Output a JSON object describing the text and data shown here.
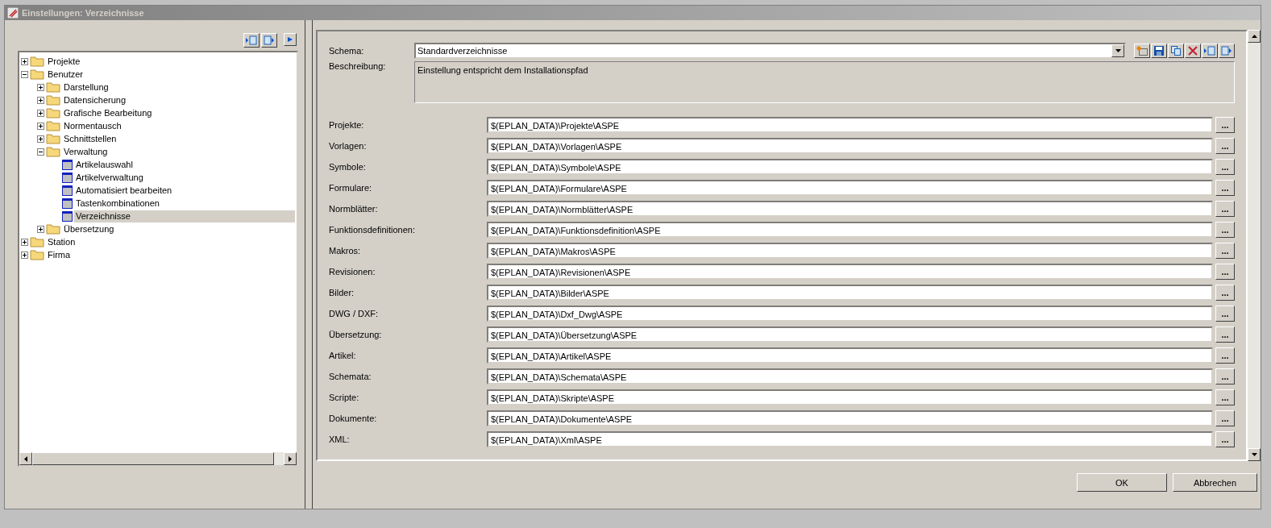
{
  "window": {
    "title": "Einstellungen: Verzeichnisse"
  },
  "tree": {
    "items": [
      {
        "kind": "folder",
        "label": "Projekte",
        "expanded": false,
        "selected": false
      },
      {
        "kind": "folder",
        "label": "Benutzer",
        "expanded": true,
        "selected": false,
        "children": [
          {
            "kind": "folder",
            "label": "Darstellung",
            "expanded": false,
            "selected": false
          },
          {
            "kind": "folder",
            "label": "Datensicherung",
            "expanded": false,
            "selected": false
          },
          {
            "kind": "folder",
            "label": "Grafische Bearbeitung",
            "expanded": false,
            "selected": false
          },
          {
            "kind": "folder",
            "label": "Normentausch",
            "expanded": false,
            "selected": false
          },
          {
            "kind": "folder",
            "label": "Schnittstellen",
            "expanded": false,
            "selected": false
          },
          {
            "kind": "folder",
            "label": "Verwaltung",
            "expanded": true,
            "selected": false,
            "children": [
              {
                "kind": "page",
                "label": "Artikelauswahl",
                "selected": false
              },
              {
                "kind": "page",
                "label": "Artikelverwaltung",
                "selected": false
              },
              {
                "kind": "page",
                "label": "Automatisiert bearbeiten",
                "selected": false
              },
              {
                "kind": "page",
                "label": "Tastenkombinationen",
                "selected": false
              },
              {
                "kind": "page",
                "label": "Verzeichnisse",
                "selected": true
              }
            ]
          },
          {
            "kind": "folder",
            "label": "Übersetzung",
            "expanded": false,
            "selected": false
          }
        ]
      },
      {
        "kind": "folder",
        "label": "Station",
        "expanded": false,
        "selected": false
      },
      {
        "kind": "folder",
        "label": "Firma",
        "expanded": false,
        "selected": false
      }
    ]
  },
  "schema": {
    "label": "Schema:",
    "value": "Standardverzeichnisse"
  },
  "description": {
    "label": "Beschreibung:",
    "value": "Einstellung entspricht dem Installationspfad"
  },
  "paths": [
    {
      "label": "Projekte:",
      "value": "$(EPLAN_DATA)\\Projekte\\ASPE",
      "button": "..."
    },
    {
      "label": "Vorlagen:",
      "value": "$(EPLAN_DATA)\\Vorlagen\\ASPE",
      "button": "..."
    },
    {
      "label": "Symbole:",
      "value": "$(EPLAN_DATA)\\Symbole\\ASPE",
      "button": "..."
    },
    {
      "label": "Formulare:",
      "value": "$(EPLAN_DATA)\\Formulare\\ASPE",
      "button": "..."
    },
    {
      "label": "Normblätter:",
      "value": "$(EPLAN_DATA)\\Normblätter\\ASPE",
      "button": "..."
    },
    {
      "label": "Funktionsdefinitionen:",
      "value": "$(EPLAN_DATA)\\Funktionsdefinition\\ASPE",
      "button": "..."
    },
    {
      "label": "Makros:",
      "value": "$(EPLAN_DATA)\\Makros\\ASPE",
      "button": "..."
    },
    {
      "label": "Revisionen:",
      "value": "$(EPLAN_DATA)\\Revisionen\\ASPE",
      "button": "..."
    },
    {
      "label": "Bilder:",
      "value": "$(EPLAN_DATA)\\Bilder\\ASPE",
      "button": "..."
    },
    {
      "label": "DWG / DXF:",
      "value": "$(EPLAN_DATA)\\Dxf_Dwg\\ASPE",
      "button": "..."
    },
    {
      "label": "Übersetzung:",
      "value": "$(EPLAN_DATA)\\Übersetzung\\ASPE",
      "button": "..."
    },
    {
      "label": "Artikel:",
      "value": "$(EPLAN_DATA)\\Artikel\\ASPE",
      "button": "..."
    },
    {
      "label": "Schemata:",
      "value": "$(EPLAN_DATA)\\Schemata\\ASPE",
      "button": "..."
    },
    {
      "label": "Scripte:",
      "value": "$(EPLAN_DATA)\\Skripte\\ASPE",
      "button": "..."
    },
    {
      "label": "Dokumente:",
      "value": "$(EPLAN_DATA)\\Dokumente\\ASPE",
      "button": "..."
    },
    {
      "label": "XML:",
      "value": "$(EPLAN_DATA)\\Xml\\ASPE",
      "button": "..."
    }
  ],
  "buttons": [
    {
      "label": "OK"
    },
    {
      "label": "Abbrechen"
    }
  ]
}
